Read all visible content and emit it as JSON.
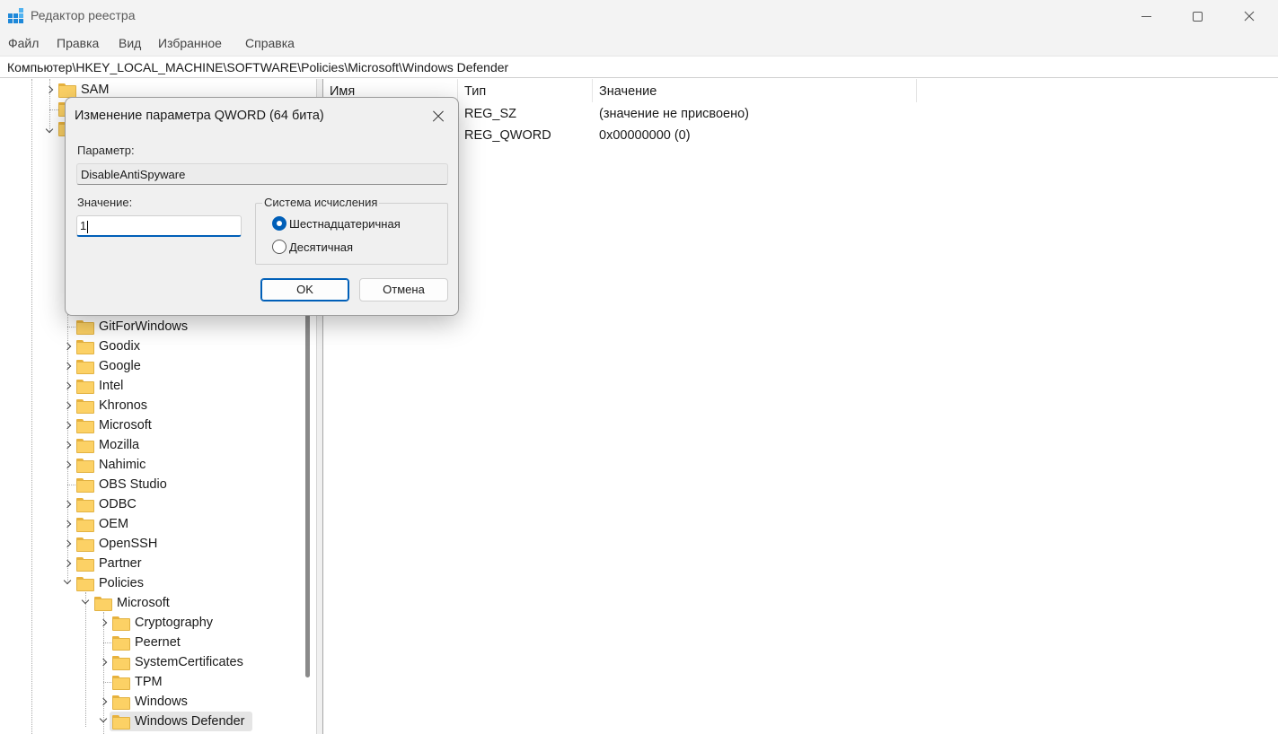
{
  "window": {
    "title": "Редактор реестра"
  },
  "menu": [
    "Файл",
    "Правка",
    "Вид",
    "Избранное",
    "Справка"
  ],
  "address": "Компьютер\\HKEY_LOCAL_MACHINE\\SOFTWARE\\Policies\\Microsoft\\Windows Defender",
  "tree": {
    "top": {
      "sam": "SAM"
    },
    "software_children": [
      "GitForWindows",
      "Goodix",
      "Google",
      "Intel",
      "Khronos",
      "Microsoft",
      "Mozilla",
      "Nahimic",
      "OBS Studio",
      "ODBC",
      "OEM",
      "OpenSSH",
      "Partner",
      "Policies"
    ],
    "policies_children": [
      "Microsoft"
    ],
    "microsoft_children": [
      "Cryptography",
      "Peernet",
      "SystemCertificates",
      "TPM",
      "Windows",
      "Windows Defender"
    ],
    "selected": "Windows Defender"
  },
  "list": {
    "columns": [
      "Имя",
      "Тип",
      "Значение"
    ],
    "rows": [
      {
        "type": "REG_SZ",
        "value": "(значение не присвоено)"
      },
      {
        "type": "REG_QWORD",
        "value": "0x00000000 (0)"
      }
    ]
  },
  "dialog": {
    "title": "Изменение параметра QWORD (64 бита)",
    "param_label": "Параметр:",
    "param_value": "DisableAntiSpyware",
    "value_label": "Значение:",
    "value_input": "1",
    "base_group_label": "Система исчисления",
    "radio_hex": "Шестнадцатеричная",
    "radio_dec": "Десятичная",
    "selected_base": "hex",
    "ok": "OK",
    "cancel": "Отмена"
  },
  "colors": {
    "accent": "#005fb8",
    "folder": "#fcd165",
    "selection": "#e5e5e5"
  }
}
